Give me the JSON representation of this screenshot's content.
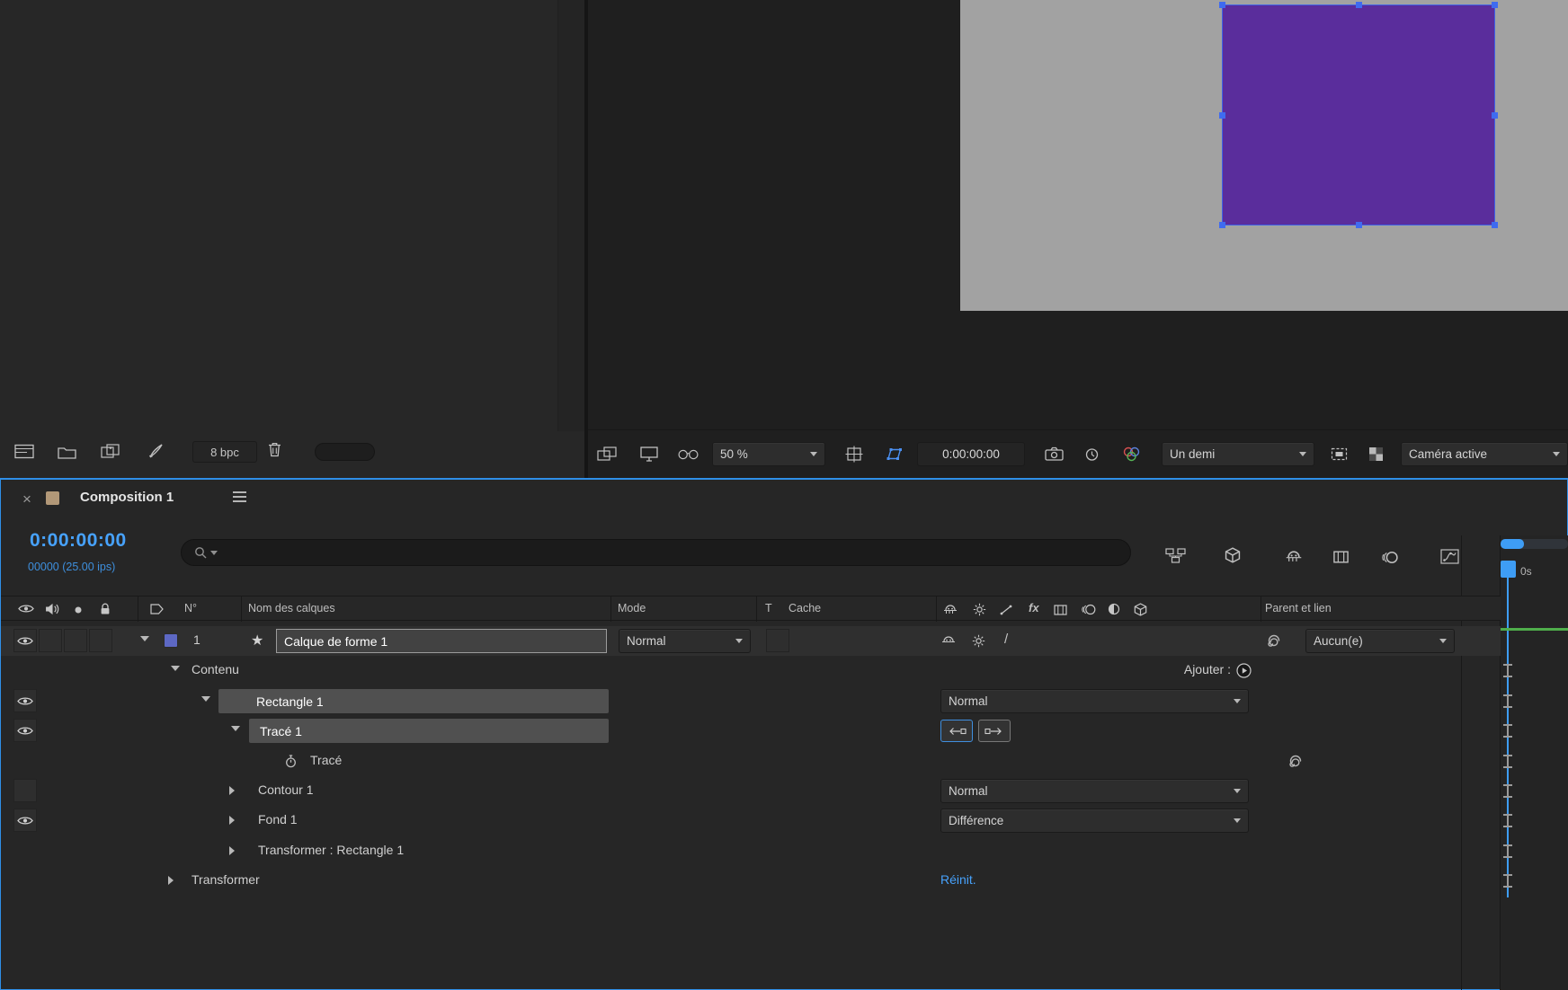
{
  "colors": {
    "accent_blue": "#47a2fc",
    "shape_fill": "#5a2d9c",
    "comp_background": "#a2a2a2",
    "layer_bar_green": "#4fae4b"
  },
  "project_panel": {
    "bpc": "8 bpc"
  },
  "viewer": {
    "zoom": "50 %",
    "timecode": "0:00:00:00",
    "resolution": "Un demi",
    "view": "Caméra active"
  },
  "timeline": {
    "tab_title": "Composition 1",
    "timecode": "0:00:00:00",
    "frame_info": "00000 (25.00 ips)",
    "ruler_label": "0s",
    "columns": {
      "number": "N°",
      "name": "Nom des calques",
      "mode": "Mode",
      "t": "T",
      "cache": "Cache",
      "parent": "Parent et lien"
    },
    "layer": {
      "index": "1",
      "name": "Calque de forme 1",
      "mode": "Normal",
      "parent": "Aucun(e)"
    },
    "contenu": {
      "label": "Contenu",
      "add": "Ajouter :"
    },
    "rectangle": {
      "label": "Rectangle 1",
      "mode": "Normal"
    },
    "trace_group": {
      "label": "Tracé 1"
    },
    "trace_prop": {
      "label": "Tracé"
    },
    "contour": {
      "label": "Contour 1",
      "mode": "Normal"
    },
    "fond": {
      "label": "Fond 1",
      "mode": "Différence"
    },
    "transform_rect": {
      "label": "Transformer : Rectangle 1"
    },
    "transform": {
      "label": "Transformer",
      "reset": "Réinit."
    }
  }
}
